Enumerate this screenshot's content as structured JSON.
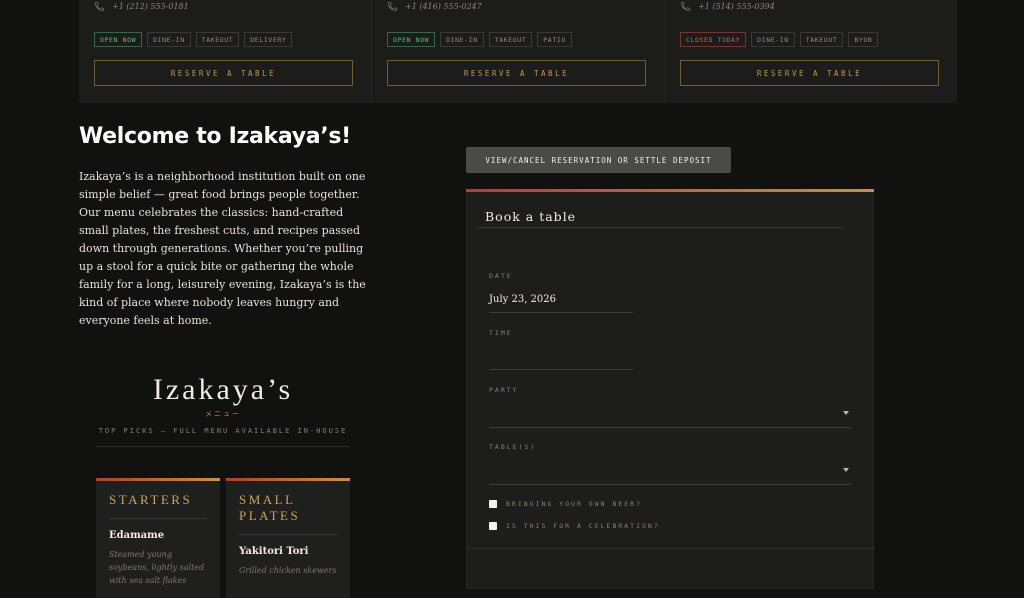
{
  "locations": [
    {
      "phone": "+1 (212) 555-0181",
      "status": "OPEN NOW",
      "tags": [
        "DINE-IN",
        "TAKEOUT",
        "DELIVERY"
      ],
      "reserve_label": "RESERVE A TABLE"
    },
    {
      "phone": "+1 (416) 555-0247",
      "status": "OPEN NOW",
      "tags": [
        "DINE-IN",
        "TAKEOUT",
        "PATIO"
      ],
      "reserve_label": "RESERVE A TABLE"
    },
    {
      "phone": "+1 (514) 555-0394",
      "status": "CLOSED TODAY",
      "tags": [
        "DINE-IN",
        "TAKEOUT",
        "BYOB"
      ],
      "reserve_label": "RESERVE A TABLE"
    }
  ],
  "welcome": {
    "title": "Welcome to Izakaya’s!",
    "body": "Izakaya’s is a neighborhood institution built on one simple belief — great food brings people together. Our menu celebrates the classics: hand-crafted small plates, the freshest cuts, and recipes passed down through generations. Whether you’re pulling up a stool for a quick bite or gathering the whole family for a long, leisurely evening, Izakaya’s is the kind of place where nobody leaves hungry and everyone feels at home."
  },
  "menu": {
    "brand": "Izakaya’s",
    "japanese": "メニュー",
    "subtitle": "TOP PICKS — FULL MENU AVAILABLE IN-HOUSE",
    "categories": [
      {
        "title": "STARTERS",
        "item_name": "Edamame",
        "item_desc": "Steamed young soybeans, lightly salted with sea salt flakes"
      },
      {
        "title": "SMALL PLATES",
        "item_name": "Yakitori Tori",
        "item_desc": "Grilled chicken skewers"
      }
    ]
  },
  "actions": {
    "view_cancel_label": "VIEW/CANCEL RESERVATION OR SETTLE DEPOSIT"
  },
  "booking": {
    "title": "Book a table",
    "date_label": "DATE",
    "date_value": "July 23, 2026",
    "time_label": "TIME",
    "time_value": "",
    "party_label": "PARTY",
    "party_value": "",
    "tables_label": "TABLE(S)",
    "tables_value": "",
    "byob_label": "BRINGING YOUR OWN BEER?",
    "celebration_label": "IS THIS FOR A CELEBRATION?"
  },
  "colors": {
    "background": "#111110",
    "accent_gold": "#c49a4a",
    "accent_red": "#b63e2c",
    "open_green": "#4ec27a",
    "closed_red": "#e05a4e"
  }
}
